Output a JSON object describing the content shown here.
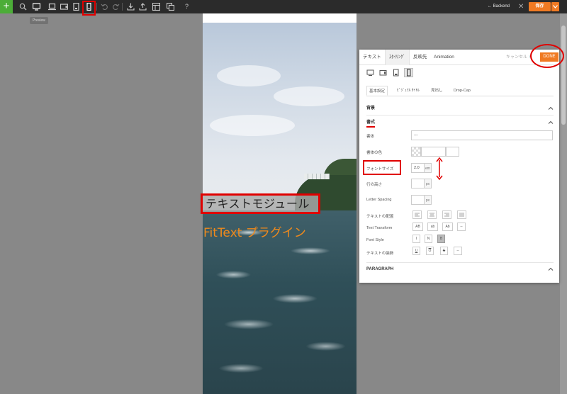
{
  "toolbar": {
    "add_icon": "plus-icon",
    "tooltip": "Preview",
    "backend_label": "Backend",
    "save_label": "保存",
    "close_icon": "close-icon"
  },
  "canvas": {
    "text_module": "テキストモジュール",
    "fittext": "FitText プラグイン"
  },
  "panel": {
    "tabs": [
      "テキスト",
      "ｽﾀｲﾘﾝｸﾞ",
      "反映先",
      "Animation"
    ],
    "cancel_label": "キャンセル",
    "done_label": "DONE",
    "subtabs": [
      "基本設定",
      "ﾋﾞｼﾞｭｱﾙ ﾀｲﾄﾙ",
      "見出し",
      "Drop-Cap"
    ],
    "sections": {
      "background": "背景",
      "typography": "書式",
      "paragraph": "PARAGRAPH"
    },
    "fields": {
      "font_label": "書体",
      "font_value": "---",
      "font_color_label": "書体の色",
      "font_size_label": "フォントサイズ",
      "font_size_value": "2.0",
      "font_size_unit": "em",
      "line_height_label": "行の高さ",
      "line_height_unit": "px",
      "letter_spacing_label": "Letter Spacing",
      "letter_spacing_unit": "px",
      "text_align_label": "テキストの配置",
      "text_transform_label": "Text Transform",
      "text_transform_options": [
        "AB",
        "ab",
        "Ab",
        "--"
      ],
      "font_style_label": "Font Style",
      "font_style_options": [
        "I",
        "N",
        "B"
      ],
      "decoration_label": "テキストの装飾",
      "decoration_options": [
        "U",
        "O",
        "S",
        "--"
      ]
    }
  },
  "colors": {
    "accent": "#f07a23",
    "highlight": "#e00000",
    "toolbar_bg": "#2b2b2b",
    "add_green": "#4cad38",
    "fittext_orange": "#f08a1c"
  }
}
